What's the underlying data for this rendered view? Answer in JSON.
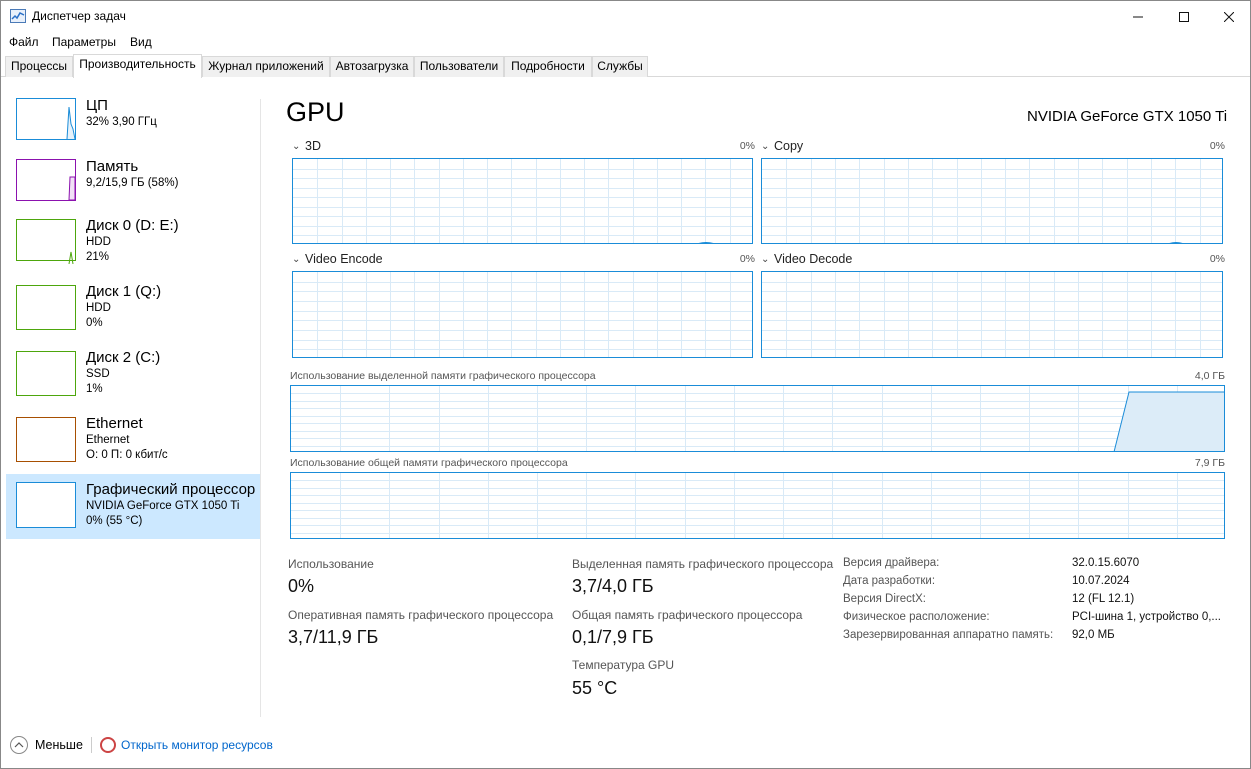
{
  "window": {
    "title": "Диспетчер задач"
  },
  "menu": [
    "Файл",
    "Параметры",
    "Вид"
  ],
  "tabs": [
    "Процессы",
    "Производительность",
    "Журнал приложений",
    "Автозагрузка",
    "Пользователи",
    "Подробности",
    "Службы"
  ],
  "active_tab": "Производительность",
  "sidebar": {
    "items": [
      {
        "title": "ЦП",
        "lines": [
          "32% 3,90 ГГц"
        ],
        "color": "#1a8cd8"
      },
      {
        "title": "Память",
        "lines": [
          "9,2/15,9 ГБ (58%)"
        ],
        "color": "#8b12ae"
      },
      {
        "title": "Диск 0 (D: E:)",
        "lines": [
          "HDD",
          "21%"
        ],
        "color": "#4da60c"
      },
      {
        "title": "Диск 1 (Q:)",
        "lines": [
          "HDD",
          "0%"
        ],
        "color": "#4da60c"
      },
      {
        "title": "Диск 2 (C:)",
        "lines": [
          "SSD",
          "1%"
        ],
        "color": "#4da60c"
      },
      {
        "title": "Ethernet",
        "lines": [
          "Ethernet",
          "О: 0 П: 0 кбит/с"
        ],
        "color": "#a74f01"
      },
      {
        "title": "Графический процессор",
        "lines": [
          "NVIDIA GeForce GTX 1050 Ti",
          "0% (55 °C)"
        ],
        "color": "#1a8cd8"
      }
    ]
  },
  "main": {
    "title": "GPU",
    "device": "NVIDIA GeForce GTX 1050 Ti",
    "engines": [
      {
        "label": "3D",
        "value": "0%"
      },
      {
        "label": "Copy",
        "value": "0%"
      },
      {
        "label": "Video Encode",
        "value": "0%"
      },
      {
        "label": "Video Decode",
        "value": "0%"
      }
    ],
    "dedicated_mem": {
      "label": "Использование выделенной памяти графического процессора",
      "max": "4,0 ГБ"
    },
    "shared_mem": {
      "label": "Использование общей памяти графического процессора",
      "max": "7,9 ГБ"
    }
  },
  "stats": {
    "usage_label": "Использование",
    "usage_value": "0%",
    "gpu_ram_label": "Оперативная память графического процессора",
    "gpu_ram_value": "3,7/11,9 ГБ",
    "dedicated_label": "Выделенная память графического процессора",
    "dedicated_value": "3,7/4,0 ГБ",
    "shared_label": "Общая память графического процессора",
    "shared_value": "0,1/7,9 ГБ",
    "temp_label": "Температура GPU",
    "temp_value": "55 °C"
  },
  "info": [
    {
      "key": "Версия драйвера:",
      "value": "32.0.15.6070"
    },
    {
      "key": "Дата разработки:",
      "value": "10.07.2024"
    },
    {
      "key": "Версия DirectX:",
      "value": "12 (FL 12.1)"
    },
    {
      "key": "Физическое расположение:",
      "value": "PCI-шина 1, устройство 0,..."
    },
    {
      "key": "Зарезервированная аппаратно память:",
      "value": "92,0 МБ"
    }
  ],
  "footer": {
    "less": "Меньше",
    "resmon": "Открыть монитор ресурсов"
  },
  "colors": {
    "accent": "#1a8cd8",
    "selected": "#cce8ff",
    "grid": "#d9eaf7",
    "link": "#0066cc"
  }
}
